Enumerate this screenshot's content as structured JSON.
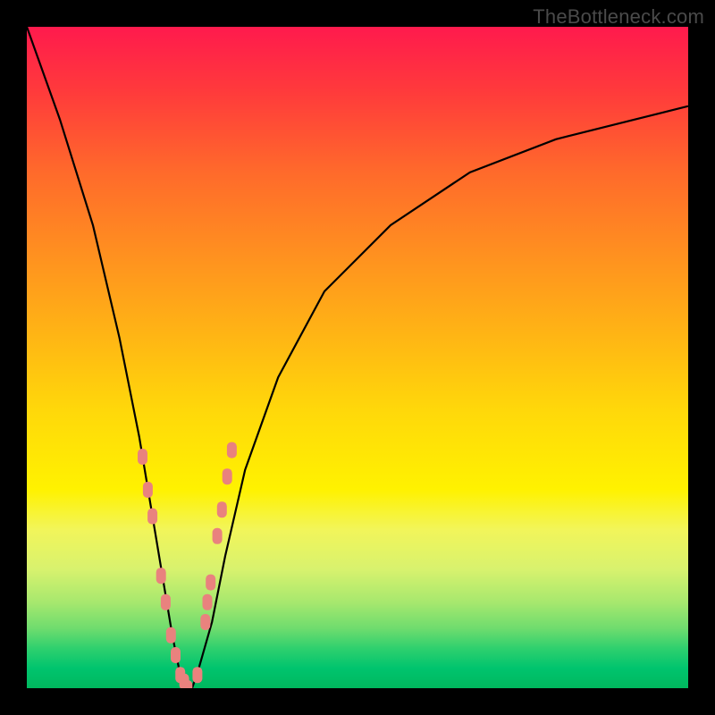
{
  "watermark": "TheBottleneck.com",
  "colors": {
    "frame": "#000000",
    "marker": "#e9827e",
    "curve": "#000000",
    "gradient_top": "#ff1a4d",
    "gradient_bottom": "#00b85e"
  },
  "chart_data": {
    "type": "line",
    "title": "",
    "xlabel": "",
    "ylabel": "",
    "xlim": [
      0,
      100
    ],
    "ylim": [
      0,
      100
    ],
    "grid": false,
    "legend": false,
    "series": [
      {
        "name": "bottleneck-curve",
        "x": [
          0,
          5,
          10,
          14,
          17,
          19,
          21,
          22,
          23,
          24,
          25,
          26,
          28,
          30,
          33,
          38,
          45,
          55,
          67,
          80,
          92,
          100
        ],
        "values": [
          100,
          86,
          70,
          53,
          38,
          26,
          14,
          8,
          3,
          0,
          0,
          3,
          10,
          20,
          33,
          47,
          60,
          70,
          78,
          83,
          86,
          88
        ]
      }
    ],
    "markers": {
      "name": "highlighted-points",
      "shape": "rounded-rect",
      "x": [
        17.5,
        18.3,
        19.0,
        20.3,
        21.0,
        21.8,
        22.5,
        23.2,
        23.8,
        24.3,
        25.8,
        27.0,
        27.3,
        27.8,
        28.8,
        29.5,
        30.3,
        31.0
      ],
      "values": [
        35,
        30,
        26,
        17,
        13,
        8,
        5,
        2,
        1,
        0,
        2,
        10,
        13,
        16,
        23,
        27,
        32,
        36
      ]
    }
  }
}
